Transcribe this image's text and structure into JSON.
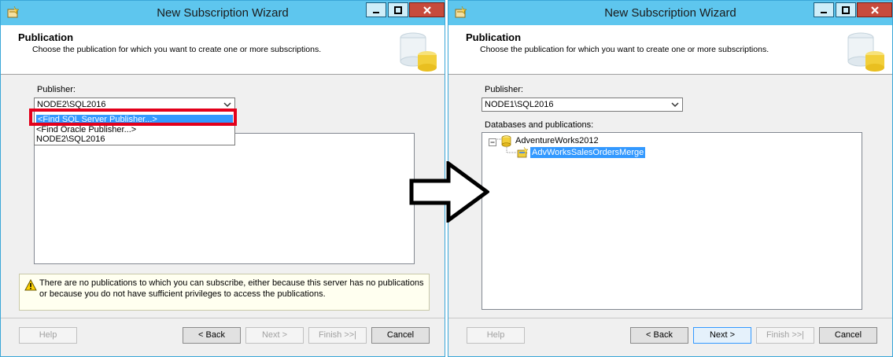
{
  "left_window": {
    "title": "New Subscription Wizard",
    "header": {
      "title": "Publication",
      "subtitle": "Choose the publication for which you want to create one or more subscriptions."
    },
    "publisher_label": "Publisher:",
    "publisher_value": "NODE2\\SQL2016",
    "dropdown_options": [
      "<Find SQL Server Publisher...>",
      "<Find Oracle Publisher...>",
      "NODE2\\SQL2016"
    ],
    "dropdown_selected_index": 0,
    "warning_text": "There are no publications to which you can subscribe, either because this server has no publications or because you do not have sufficient privileges to access the publications.",
    "buttons": {
      "help": "Help",
      "back": "< Back",
      "next": "Next >",
      "finish": "Finish >>|",
      "cancel": "Cancel"
    }
  },
  "right_window": {
    "title": "New Subscription Wizard",
    "header": {
      "title": "Publication",
      "subtitle": "Choose the publication for which you want to create one or more subscriptions."
    },
    "publisher_label": "Publisher:",
    "publisher_value": "NODE1\\SQL2016",
    "tree_label": "Databases and publications:",
    "tree": {
      "database": "AdventureWorks2012",
      "publication": "AdvWorksSalesOrdersMerge"
    },
    "buttons": {
      "help": "Help",
      "back": "< Back",
      "next": "Next >",
      "finish": "Finish >>|",
      "cancel": "Cancel"
    }
  },
  "colors": {
    "titlebar": "#5ec6ee",
    "highlight": "#3399ff",
    "callout_red": "#e3001b",
    "close_button": "#c74b3c"
  },
  "icons": [
    "wizard-app-icon",
    "minimize-icon",
    "maximize-icon",
    "close-icon",
    "database-art-icon",
    "dropdown-arrow-icon",
    "warning-icon",
    "database-icon",
    "merge-publication-icon",
    "tree-expander-icon",
    "right-arrow-icon"
  ]
}
